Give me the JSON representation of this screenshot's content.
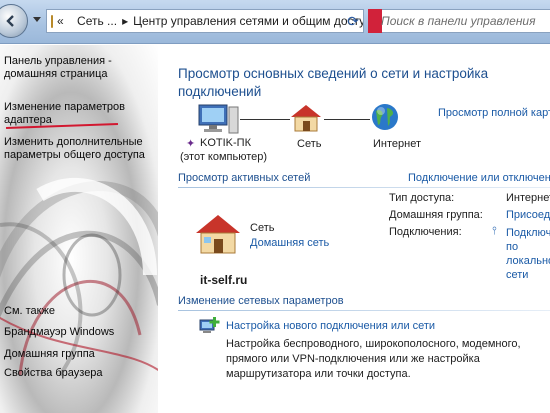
{
  "address_bar": {
    "breadcrumb_root": "«",
    "crumbs": [
      "Сеть ...",
      "Центр управления сетями и общим доступом"
    ],
    "search_placeholder": "Поиск в панели управления"
  },
  "sidebar": {
    "items": [
      {
        "label": "Панель управления - домашняя страница"
      },
      {
        "label": "Изменение параметров адаптера"
      },
      {
        "label": "Изменить дополнительные параметры общего доступа"
      }
    ],
    "see_also_title": "См. также",
    "see_also": [
      "Брандмауэр Windows",
      "Домашняя группа",
      "Свойства браузера"
    ]
  },
  "main": {
    "title": "Просмотр основных сведений о сети и настройка подключений",
    "full_map_link": "Просмотр полной карты",
    "map": {
      "computer_name": "KOTIK-ПК",
      "computer_sub": "(этот компьютер)",
      "network": "Сеть",
      "internet": "Интернет"
    },
    "active_networks_heading": "Просмотр активных сетей",
    "connect_disconnect_link": "Подключение или отключение",
    "network": {
      "name": "Сеть",
      "type": "Домашняя сеть",
      "access_type_label": "Тип доступа:",
      "access_type_value": "Интернет",
      "homegroup_label": "Домашняя группа:",
      "homegroup_value": "Присоединиться",
      "connections_label": "Подключения:",
      "connections_value": "Подключение по локальной сети"
    },
    "watermark": "it-self.ru",
    "change_settings_heading": "Изменение сетевых параметров",
    "new_connection_link": "Настройка нового подключения или сети",
    "new_connection_desc": "Настройка беспроводного, широкополосного, модемного, прямого или VPN-подключения или же настройка маршрутизатора или точки доступа."
  },
  "colors": {
    "link": "#1a5aa6",
    "heading": "#1d4f8f",
    "annotation": "#d21830"
  }
}
